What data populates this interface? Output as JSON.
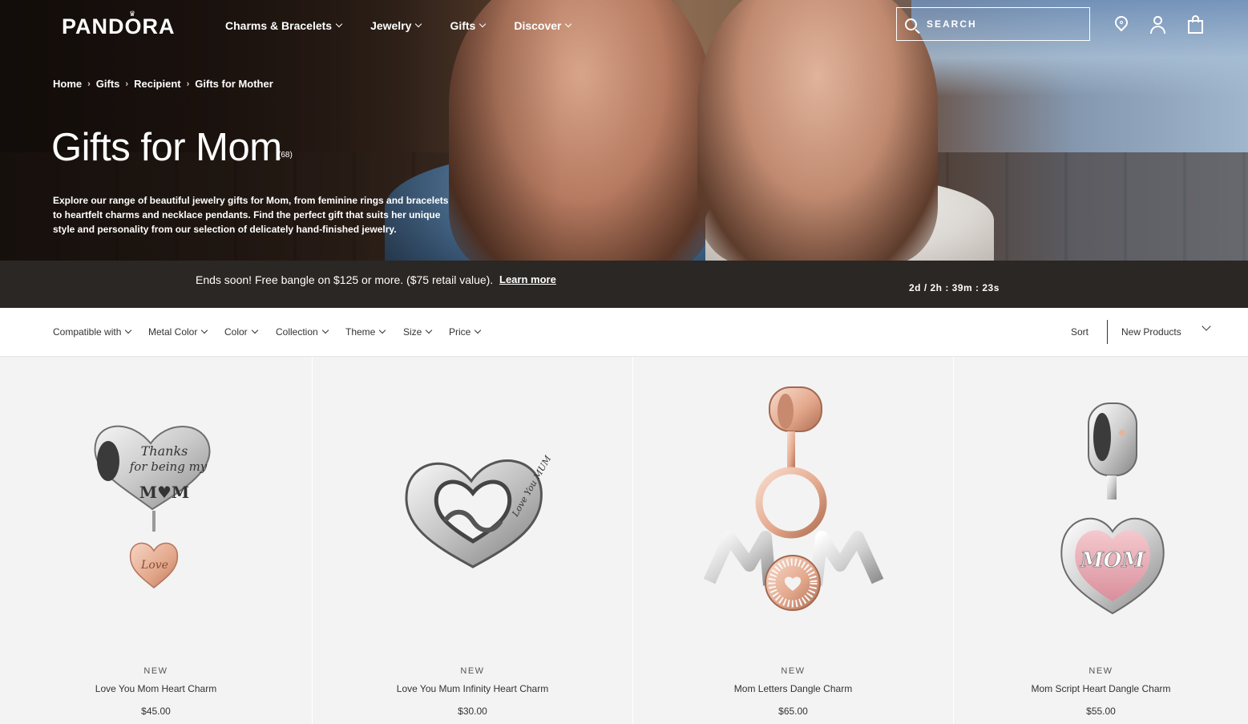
{
  "header": {
    "logo": "PANDORA",
    "nav": [
      {
        "label": "Charms & Bracelets"
      },
      {
        "label": "Jewelry"
      },
      {
        "label": "Gifts"
      },
      {
        "label": "Discover"
      }
    ],
    "search_placeholder": "SEARCH",
    "icons": [
      "map-pin-icon",
      "account-icon",
      "shopping-bag-icon"
    ]
  },
  "breadcrumb": [
    "Home",
    "Gifts",
    "Recipient",
    "Gifts for Mother"
  ],
  "page": {
    "title": "Gifts for Mom",
    "count": "(68)",
    "description": "Explore our range of beautiful jewelry gifts for Mom, from feminine rings and bracelets to heartfelt charms and necklace pendants. Find the perfect gift that suits her unique style and personality from our selection of delicately hand-finished jewelry."
  },
  "promo": {
    "text": "Ends soon! Free bangle on $125 or more. ($75 retail value).",
    "link": "Learn more",
    "timer": "2d / 2h : 39m : 23s"
  },
  "filters": [
    "Compatible with",
    "Metal Color",
    "Color",
    "Collection",
    "Theme",
    "Size",
    "Price"
  ],
  "sort": {
    "label": "Sort",
    "value": "New Products"
  },
  "products": [
    {
      "badge": "NEW",
      "name": "Love You Mom Heart Charm",
      "price": "$45.00",
      "engraving": "Thanks for being my MOM",
      "dangle": "Love"
    },
    {
      "badge": "NEW",
      "name": "Love You Mum Infinity Heart Charm",
      "price": "$30.00",
      "engraving": "Love You MUM"
    },
    {
      "badge": "NEW",
      "name": "Mom Letters Dangle Charm",
      "price": "$65.00"
    },
    {
      "badge": "NEW",
      "name": "Mom Script Heart Dangle Charm",
      "price": "$55.00",
      "engraving": "MOM"
    }
  ],
  "colors": {
    "promo_bg": "#2a2724",
    "card_bg": "#f3f3f3",
    "rose_gold": "#e8b59d",
    "silver": "#c8c8c8"
  }
}
